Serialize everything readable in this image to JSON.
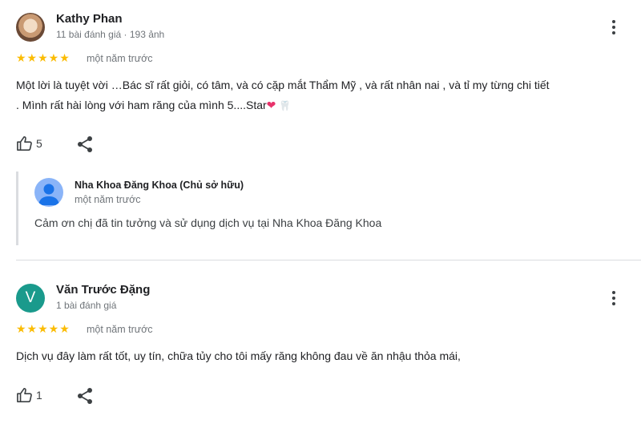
{
  "reviews": [
    {
      "author": "Kathy Phan",
      "meta": "11 bài đánh giá · 193 ảnh",
      "stars": "★★★★★",
      "when": "một năm trước",
      "text_line1": "Một lời là tuyệt vời …Bác sĩ rất giỏi, có tâm, và có cặp mắt Thẩm Mỹ , và rất nhân nai , và tỉ my từng chi tiết",
      "text_line2": ". Mình rất hài lòng với ham răng của mình 5....Star",
      "likes": "5",
      "owner_reply": {
        "name": "Nha Khoa Đăng Khoa (Chủ sở hữu)",
        "when": "một năm trước",
        "text": "Cảm ơn chị đã tin tưởng và sử dụng dịch vụ tại Nha Khoa Đăng Khoa"
      }
    },
    {
      "author": "Văn Trước Đặng",
      "avatar_letter": "V",
      "meta": "1 bài đánh giá",
      "stars": "★★★★★",
      "when": "một năm trước",
      "text_line1": "Dịch vụ đây làm rất tốt, uy tín, chữa tủy cho tôi mấy răng không đau về ăn nhậu thỏa mái,",
      "likes": "1"
    }
  ],
  "colors": {
    "star": "#fbbc04",
    "avatar_v": "#1a9a8c",
    "owner_avatar": "#8ab4f8"
  },
  "icons": [
    "thumbs-up-icon",
    "share-icon",
    "more-vert-icon",
    "heart-emoji-icon",
    "tooth-emoji-icon",
    "person-icon"
  ]
}
